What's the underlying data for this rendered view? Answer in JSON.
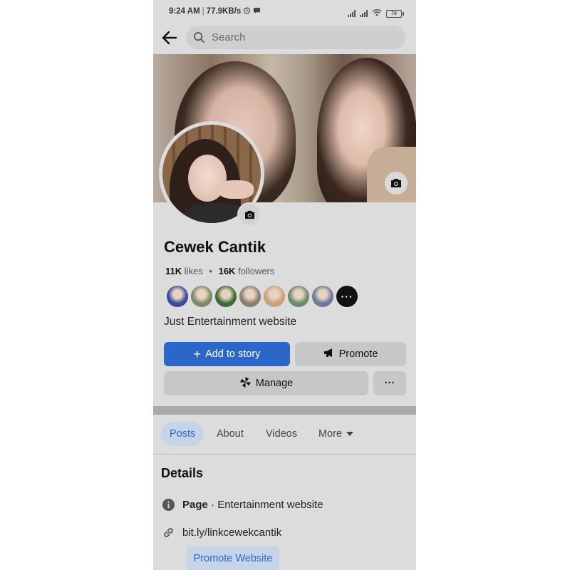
{
  "status_bar": {
    "time": "9:24 AM",
    "speed": "77.9KB/s",
    "battery": "78"
  },
  "search": {
    "placeholder": "Search"
  },
  "profile": {
    "name": "Cewek Cantik",
    "likes_count": "11K",
    "likes_label": "likes",
    "followers_count": "16K",
    "followers_label": "followers",
    "bio": "Just Entertainment website"
  },
  "friend_avatars": [
    {
      "color": "#3a4a9a"
    },
    {
      "color": "#7a8a6a"
    },
    {
      "color": "#3e6b35"
    },
    {
      "color": "#8a7d72"
    },
    {
      "color": "#c9a27a"
    },
    {
      "color": "#6c8a6c"
    },
    {
      "color": "#6a7a9a"
    }
  ],
  "actions": {
    "add_to_story": "Add to story",
    "promote": "Promote",
    "manage": "Manage",
    "more": "···"
  },
  "tabs": {
    "posts": "Posts",
    "about": "About",
    "videos": "Videos",
    "more": "More"
  },
  "details": {
    "title": "Details",
    "category_label": "Page",
    "category_value": "· Entertainment website",
    "link": "bit.ly/linkcewekcantik",
    "promote_website": "Promote Website"
  },
  "colors": {
    "accent": "#2b67c9",
    "background": "#dcdcdc",
    "button_gray": "#c7c7c7"
  }
}
